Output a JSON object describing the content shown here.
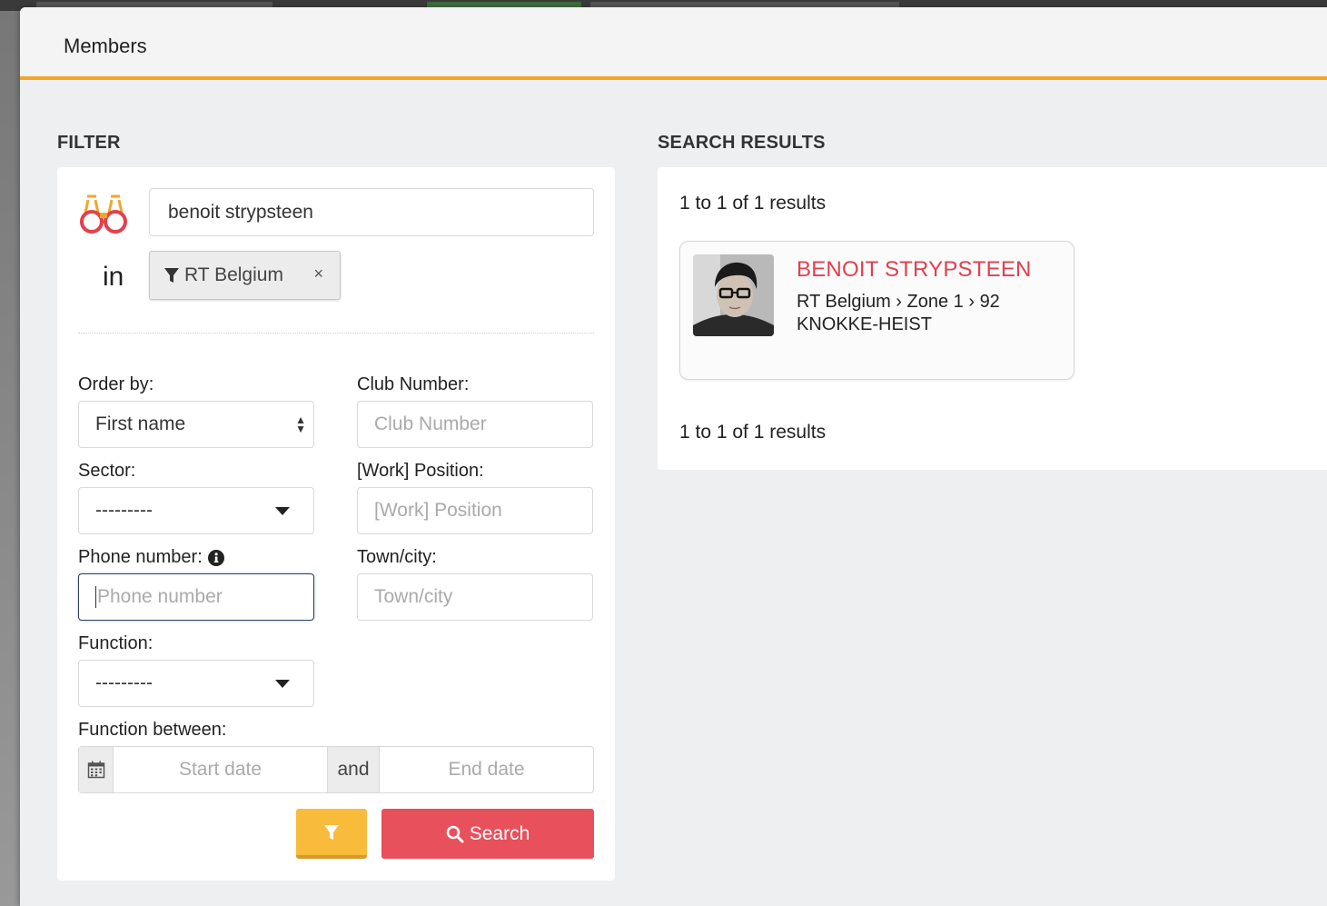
{
  "modal": {
    "title": "Members"
  },
  "filter": {
    "section_title": "FILTER",
    "search_value": "benoit strypsteen",
    "in_label": "in",
    "chip_label": "RT Belgium",
    "chip_close": "×",
    "order_by": {
      "label": "Order by:",
      "value": "First name"
    },
    "club_number": {
      "label": "Club Number:",
      "placeholder": "Club Number"
    },
    "sector": {
      "label": "Sector:",
      "value": "---------"
    },
    "work_position": {
      "label": "[Work] Position:",
      "placeholder": "[Work] Position"
    },
    "phone": {
      "label": "Phone number:",
      "placeholder": "Phone number"
    },
    "town": {
      "label": "Town/city:",
      "placeholder": "Town/city"
    },
    "function": {
      "label": "Function:",
      "value": "---------"
    },
    "function_between": {
      "label": "Function between:",
      "start_placeholder": "Start date",
      "and_label": "and",
      "end_placeholder": "End date"
    },
    "search_button": "Search"
  },
  "results": {
    "section_title": "SEARCH RESULTS",
    "summary_top": "1 to 1 of 1 results",
    "summary_bottom": "1 to 1 of 1 results",
    "items": [
      {
        "name": "BENOIT STRYPSTEEN",
        "path_line1": "RT Belgium › Zone 1 › 92",
        "path_line2": "KNOKKE-HEIST"
      }
    ]
  },
  "colors": {
    "accent": "#f2a62a",
    "danger": "#e8505b",
    "name": "#e2404d",
    "filter_btn": "#f8bb3b"
  },
  "icons": [
    "binoculars-icon",
    "filter-icon",
    "close-icon",
    "info-icon",
    "calendar-icon",
    "search-icon",
    "caret-down-icon",
    "sort-arrows-icon"
  ]
}
